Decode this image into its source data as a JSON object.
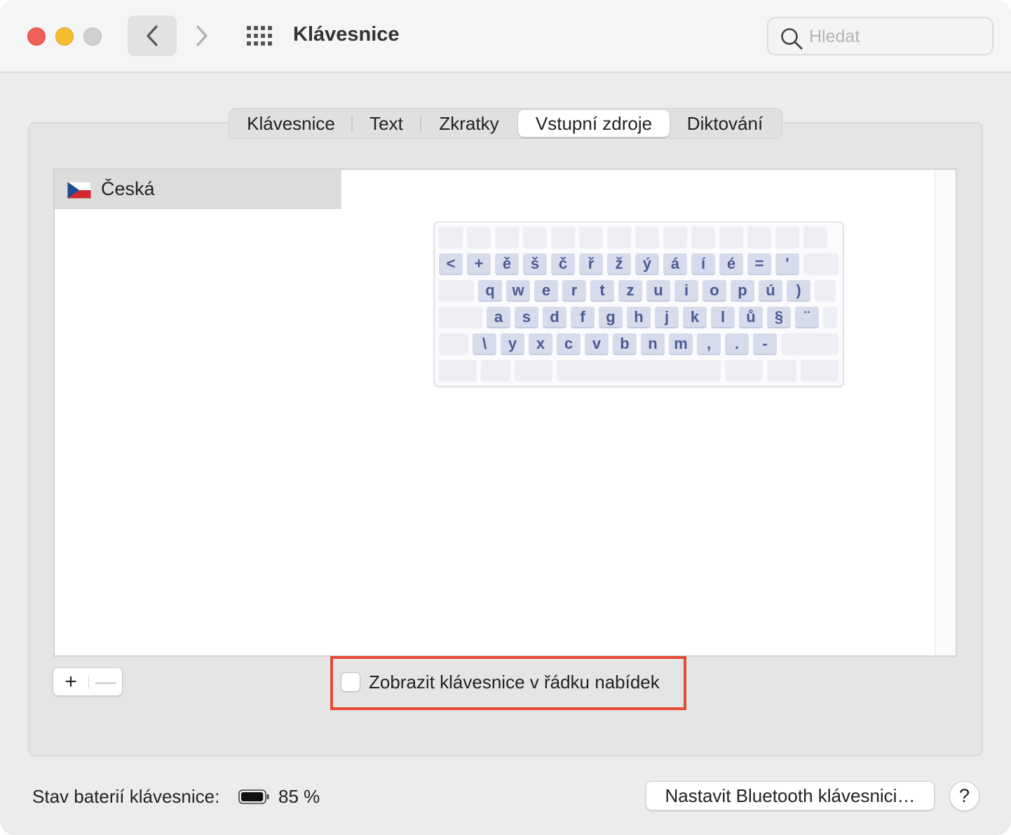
{
  "window": {
    "title": "Klávesnice"
  },
  "search": {
    "placeholder": "Hledat"
  },
  "tabs": [
    {
      "label": "Klávesnice",
      "selected": false
    },
    {
      "label": "Text",
      "selected": false
    },
    {
      "label": "Zkratky",
      "selected": false
    },
    {
      "label": "Vstupní zdroje",
      "selected": true
    },
    {
      "label": "Diktování",
      "selected": false
    }
  ],
  "input_sources": {
    "items": [
      {
        "label": "Česká",
        "icon": "czech-flag-icon",
        "selected": true
      }
    ]
  },
  "keyboard_layout": {
    "rows": [
      [],
      [
        "<",
        "+",
        "ě",
        "š",
        "č",
        "ř",
        "ž",
        "ý",
        "á",
        "í",
        "é",
        "=",
        "'"
      ],
      [
        "q",
        "w",
        "e",
        "r",
        "t",
        "z",
        "u",
        "i",
        "o",
        "p",
        "ú",
        ")"
      ],
      [
        "a",
        "s",
        "d",
        "f",
        "g",
        "h",
        "j",
        "k",
        "l",
        "ů",
        "§",
        "¨"
      ],
      [
        "\\",
        "y",
        "x",
        "c",
        "v",
        "b",
        "n",
        "m",
        ",",
        ".",
        "-"
      ]
    ]
  },
  "controls": {
    "add_label": "+",
    "remove_label": "—",
    "show_in_menu_bar_label": "Zobrazit klávesnice v řádku nabídek",
    "show_in_menu_bar_checked": false
  },
  "footer": {
    "battery_label": "Stav baterií klávesnice:",
    "battery_percent": "85 %",
    "battery_level": 0.85,
    "bluetooth_button_label": "Nastavit Bluetooth klávesnici…",
    "help_label": "?"
  },
  "colors": {
    "close": "#ee5f57",
    "minimize": "#f5bd2f",
    "zoom_inactive": "#cfcfcf",
    "highlight_frame": "#e44a33",
    "key_text": "#4c5a93"
  }
}
